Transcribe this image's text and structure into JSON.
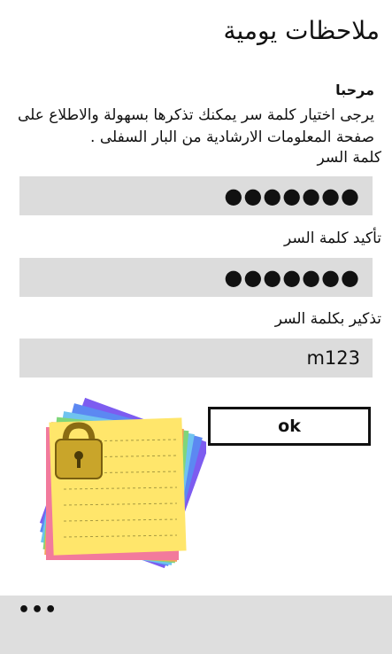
{
  "app": {
    "title": "ملاحظات يومية"
  },
  "intro": {
    "welcome": "مرحبا",
    "description": "يرجى اختيار كلمة سر يمكنك تذكرها بسهولة والاطلاع على صفحة المعلومات الارشادية من البار السفلى ."
  },
  "form": {
    "password_label": "كلمة السر",
    "password_value": "●●●●●●●",
    "confirm_label": "تأكيد كلمة السر",
    "confirm_value": "●●●●●●●",
    "hint_label": "تذكير بكلمة السر",
    "hint_value": "m123"
  },
  "actions": {
    "ok_label": "ok"
  },
  "appbar": {
    "more_label": "•••"
  },
  "illustration": {
    "icon": "sticky-notes-lock-icon"
  }
}
